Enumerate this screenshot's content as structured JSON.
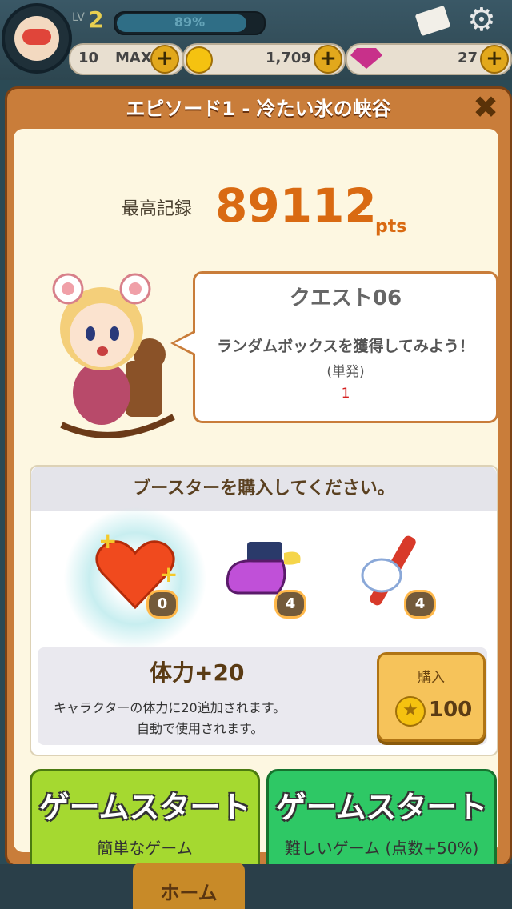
{
  "header": {
    "level_prefix": "LV",
    "level": "2",
    "xp_percent": 89,
    "xp_text": "89%",
    "hearts_count": "10",
    "hearts_max": "MAX",
    "coins": "1,709",
    "gems": "27"
  },
  "dialog": {
    "title": "エピソード1 - 冷たい氷の峡谷",
    "close_icon": "close-x-icon"
  },
  "best": {
    "label": "最高記録",
    "score": "89112",
    "unit": "pts"
  },
  "quest": {
    "title": "クエスト06",
    "description": "ランダムボックスを獲得してみよう！",
    "subtext": "(単発)",
    "count": "1"
  },
  "booster": {
    "header": "ブースターを購入してください。",
    "items": [
      {
        "icon": "heart-plus-icon",
        "count": "0"
      },
      {
        "icon": "winged-shoe-icon",
        "count": "4"
      },
      {
        "icon": "dynamite-hand-icon",
        "count": "4"
      }
    ],
    "selected_name": "体力+20",
    "selected_desc1": "キャラクターの体力に20追加されます。",
    "selected_desc2": "自動で使用されます。",
    "buy_label": "購入",
    "buy_price": "100"
  },
  "start_buttons": {
    "easy_title": "ゲームスタート",
    "easy_sub": "簡単なゲーム",
    "hard_title": "ゲームスタート",
    "hard_sub": "難しいゲーム (点数+50%)"
  },
  "nav": {
    "home": "ホーム"
  },
  "colors": {
    "accent_orange": "#d96a12",
    "easy_green": "#a5d930",
    "hard_green": "#2ec865",
    "quest_red": "#d52020"
  }
}
